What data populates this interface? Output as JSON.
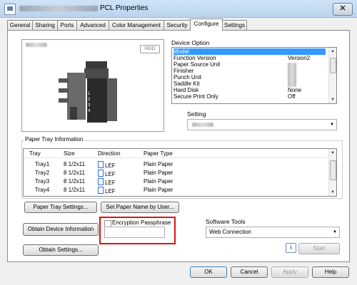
{
  "window": {
    "title": "PCL Properties",
    "close_glyph": "✕"
  },
  "tabs": [
    "General",
    "Sharing",
    "Ports",
    "Advanced",
    "Color Management",
    "Security",
    "Configure",
    "Settings"
  ],
  "active_tab": "Configure",
  "preview": {
    "hdd_label": "HDD",
    "stack_numbers": [
      "1",
      "2",
      "3",
      "4"
    ]
  },
  "device_option": {
    "label": "Device Option",
    "items": [
      {
        "name": "Model",
        "value": ""
      },
      {
        "name": "Function Version",
        "value": "Version2"
      },
      {
        "name": "Paper Source Unit",
        "value": ""
      },
      {
        "name": "Finisher",
        "value": ""
      },
      {
        "name": "Punch Unit",
        "value": ""
      },
      {
        "name": "Saddle Kit",
        "value": ""
      },
      {
        "name": "Hard Disk",
        "value": "None"
      },
      {
        "name": "Secure Print Only",
        "value": "Off"
      }
    ],
    "selected_index": 0
  },
  "setting": {
    "label": "Setting",
    "value": ""
  },
  "paper_tray": {
    "label": "Paper Tray Information",
    "headers": [
      "Tray",
      "Size",
      "Direction",
      "Paper Type"
    ],
    "rows": [
      {
        "tray": "Tray1",
        "size": "8 1/2x11",
        "direction": "LEF",
        "type": "Plain Paper"
      },
      {
        "tray": "Tray2",
        "size": "8 1/2x11",
        "direction": "LEF",
        "type": "Plain Paper"
      },
      {
        "tray": "Tray3",
        "size": "8 1/2x11",
        "direction": "LEF",
        "type": "Plain Paper"
      },
      {
        "tray": "Tray4",
        "size": "8 1/2x11",
        "direction": "LEF",
        "type": "Plain Paper"
      }
    ]
  },
  "buttons": {
    "paper_tray_settings": "Paper Tray Settings...",
    "set_paper_name": "Set Paper Name by User...",
    "obtain_device_info": "Obtain Device Information",
    "obtain_settings": "Obtain Settings...",
    "start": "Start",
    "ok": "OK",
    "cancel": "Cancel",
    "apply": "Apply",
    "help": "Help"
  },
  "encryption": {
    "label": "Encryption Passphrase",
    "checked": false,
    "value": ""
  },
  "software_tools": {
    "label": "Software Tools",
    "value": "Web Connection"
  },
  "info_glyph": "i"
}
